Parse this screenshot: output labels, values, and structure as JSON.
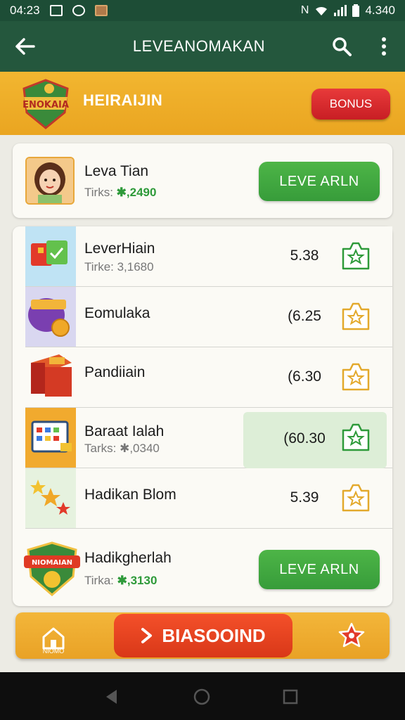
{
  "status_bar": {
    "time": "04:23",
    "battery": "4.340"
  },
  "app_bar": {
    "title": "LEVEANOMAKAN",
    "back_icon": "arrow-left-icon",
    "search_icon": "search-icon",
    "menu_icon": "more-vert-icon"
  },
  "banner": {
    "logo_text": "ENOKAIA",
    "title": "HEIRAIJIN",
    "bonus_label": "BONUS"
  },
  "top_card": {
    "name": "Leva Tian",
    "sub_label": "Tirks:",
    "sub_value": "✱,2490",
    "button_label": "LEVE ARLN"
  },
  "list": [
    {
      "name": "LeverHiain",
      "sub": "Tirke: 3,1680",
      "price": "5.38",
      "star_color": "#2e9a3a"
    },
    {
      "name": "Eomulaka",
      "sub": "",
      "price": "(6.25",
      "star_color": "#e3a92c"
    },
    {
      "name": "Pandiiain",
      "sub": "",
      "price": "(6.30",
      "star_color": "#e3a92c"
    },
    {
      "name": "Baraat Ialah",
      "sub_label": "Tarks:",
      "sub_value": "✱,0340",
      "price": "(60.30",
      "star_color": "#2e9a3a"
    },
    {
      "name": "Hadikan Blom",
      "sub": "",
      "price": "5.39",
      "star_color": "#e3a92c"
    }
  ],
  "bottom_card": {
    "badge_text": "NIOMAIAN",
    "name": "Hadikgherlah",
    "sub_label": "Tirka:",
    "sub_value": "✱,3130",
    "button_label": "LEVE ARLN"
  },
  "bottom_bar": {
    "home_label": "NIOMO",
    "cta_label": "BIASOOIND",
    "cta_icon": "chevron-right-icon",
    "fav_icon": "star-badge-icon"
  },
  "colors": {
    "header_green": "#24573d",
    "banner_orange": "#eaa521",
    "button_green": "#379c3a",
    "bonus_red": "#d9202a",
    "cta_red": "#e3401e"
  }
}
